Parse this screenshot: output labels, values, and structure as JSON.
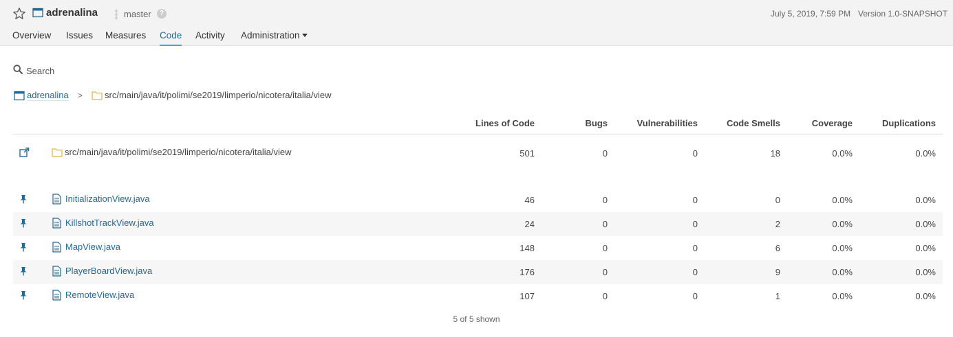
{
  "colors": {
    "link": "#236a97",
    "accent": "#4b9fd5",
    "folder": "#e2b14a",
    "topbar_bg": "#f3f3f3"
  },
  "header": {
    "project_name": "adrenalina",
    "branch": "master",
    "help_glyph": "?",
    "analysis_date": "July 5, 2019, 7:59 PM",
    "version": "Version 1.0-SNAPSHOT",
    "icons": [
      "star-icon",
      "project-icon",
      "branch-icon",
      "help-icon"
    ]
  },
  "nav": {
    "overview": "Overview",
    "issues": "Issues",
    "measures": "Measures",
    "code": "Code",
    "activity": "Activity",
    "administration": "Administration",
    "active": "Code"
  },
  "search": {
    "placeholder": "Search",
    "value": ""
  },
  "breadcrumb": {
    "project": "adrenalina",
    "separator": ">",
    "path": "src/main/java/it/polimi/se2019/limperio/nicotera/italia/view"
  },
  "table": {
    "columns": {
      "loc": "Lines of Code",
      "bugs": "Bugs",
      "vulnerabilities": "Vulnerabilities",
      "code_smells": "Code Smells",
      "coverage": "Coverage",
      "duplications": "Duplications"
    },
    "base": {
      "name": "src/main/java/it/polimi/se2019/limperio/nicotera/italia/view",
      "loc": "501",
      "bugs": "0",
      "vulnerabilities": "0",
      "code_smells": "18",
      "coverage": "0.0%",
      "duplications": "0.0%"
    },
    "files": [
      {
        "name": "InitializationView.java",
        "loc": "46",
        "bugs": "0",
        "vulnerabilities": "0",
        "code_smells": "0",
        "coverage": "0.0%",
        "duplications": "0.0%"
      },
      {
        "name": "KillshotTrackView.java",
        "loc": "24",
        "bugs": "0",
        "vulnerabilities": "0",
        "code_smells": "2",
        "coverage": "0.0%",
        "duplications": "0.0%"
      },
      {
        "name": "MapView.java",
        "loc": "148",
        "bugs": "0",
        "vulnerabilities": "0",
        "code_smells": "6",
        "coverage": "0.0%",
        "duplications": "0.0%"
      },
      {
        "name": "PlayerBoardView.java",
        "loc": "176",
        "bugs": "0",
        "vulnerabilities": "0",
        "code_smells": "9",
        "coverage": "0.0%",
        "duplications": "0.0%"
      },
      {
        "name": "RemoteView.java",
        "loc": "107",
        "bugs": "0",
        "vulnerabilities": "0",
        "code_smells": "1",
        "coverage": "0.0%",
        "duplications": "0.0%"
      }
    ]
  },
  "footer": {
    "shown": "5 of 5 shown"
  }
}
